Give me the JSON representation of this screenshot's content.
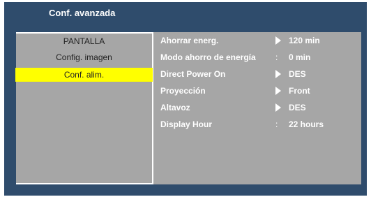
{
  "window": {
    "title": "Conf. avanzada"
  },
  "colors": {
    "panel_bg": "#2f4c6c",
    "menu_bg": "#a6a6a6",
    "highlight": "#ffff00",
    "text": "#ffffff"
  },
  "menu": {
    "items": [
      {
        "label": "PANTALLA",
        "selected": false
      },
      {
        "label": "Config. imagen",
        "selected": false
      },
      {
        "label": "Conf. alim.",
        "selected": true
      }
    ]
  },
  "settings": {
    "rows": [
      {
        "label": "Ahorrar energ.",
        "marker": "arrow",
        "value": "120 min"
      },
      {
        "label": "Modo ahorro de energía",
        "marker": ":",
        "value": "0 min"
      },
      {
        "label": "Direct Power On",
        "marker": "arrow",
        "value": "DES"
      },
      {
        "label": "Proyección",
        "marker": "arrow",
        "value": "Front"
      },
      {
        "label": "Altavoz",
        "marker": "arrow",
        "value": "DES"
      },
      {
        "label": "Display Hour",
        "marker": ":",
        "value": "22 hours"
      }
    ]
  }
}
